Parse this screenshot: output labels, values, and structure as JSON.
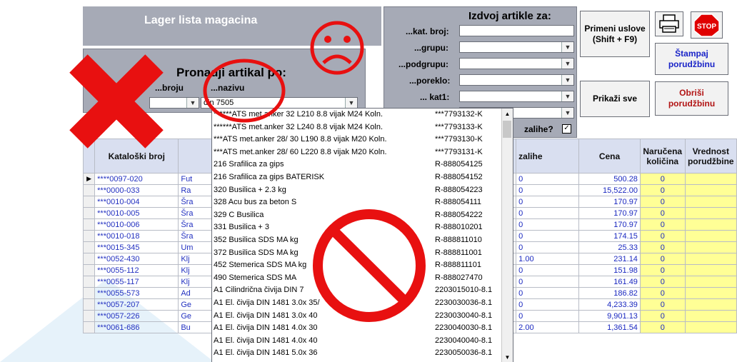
{
  "header": {
    "title": "Lager lista magacina"
  },
  "search_panel": {
    "title": "Pronadji artikal po:",
    "by_number_label": "...broju",
    "by_name_label": "...nazivu",
    "name_value": "din 7505"
  },
  "filter_panel": {
    "title": "Izdvoj artikle za:",
    "fields": [
      {
        "label": "...kat. broj:",
        "value": ""
      },
      {
        "label": "...grupu:",
        "value": ""
      },
      {
        "label": "...podgrupu:",
        "value": ""
      },
      {
        "label": "...poreklo:",
        "value": ""
      },
      {
        "label": "... kat1:",
        "value": ""
      }
    ],
    "stock_label": "zalihe?"
  },
  "buttons": {
    "apply": "Primeni uslove (Shift + F9)",
    "show_all": "Prikaži sve",
    "print_order": "Štampaj porudžbinu",
    "delete_order": "Obriši porudžbinu",
    "stop": "STOP",
    "print_icon": "printer-icon"
  },
  "table": {
    "headers": [
      "Kataloški broj",
      "",
      "zalihe",
      "Cena",
      "Naručena količina",
      "Vrednost porudžbine"
    ],
    "rows": [
      {
        "kat": "****0097-020",
        "naz": "Fut",
        "zal": "0",
        "cena": "500.28",
        "nar": "0"
      },
      {
        "kat": "***0000-033",
        "naz": "Ra",
        "zal": "0",
        "cena": "15,522.00",
        "nar": "0"
      },
      {
        "kat": "***0010-004",
        "naz": "Šra",
        "zal": "0",
        "cena": "170.97",
        "nar": "0"
      },
      {
        "kat": "***0010-005",
        "naz": "Šra",
        "zal": "0",
        "cena": "170.97",
        "nar": "0"
      },
      {
        "kat": "***0010-006",
        "naz": "Šra",
        "zal": "0",
        "cena": "170.97",
        "nar": "0"
      },
      {
        "kat": "***0010-018",
        "naz": "Šra",
        "zal": "0",
        "cena": "174.15",
        "nar": "0"
      },
      {
        "kat": "***0015-345",
        "naz": "Um",
        "zal": "0",
        "cena": "25.33",
        "nar": "0"
      },
      {
        "kat": "***0052-430",
        "naz": "Klj",
        "zal": "1.00",
        "cena": "231.14",
        "nar": "0"
      },
      {
        "kat": "***0055-112",
        "naz": "Klj",
        "zal": "0",
        "cena": "151.98",
        "nar": "0"
      },
      {
        "kat": "***0055-117",
        "naz": "Klj",
        "zal": "0",
        "cena": "161.49",
        "nar": "0"
      },
      {
        "kat": "***0055-573",
        "naz": "Ad",
        "zal": "0",
        "cena": "186.82",
        "nar": "0"
      },
      {
        "kat": "***0057-207",
        "naz": "Ge",
        "zal": "0",
        "cena": "4,233.39",
        "nar": "0"
      },
      {
        "kat": "***0057-226",
        "naz": "Ge",
        "zal": "0",
        "cena": "9,901.13",
        "nar": "0"
      },
      {
        "kat": "***0061-686",
        "naz": "Bu",
        "zal": "2.00",
        "cena": "1,361.54",
        "nar": "0"
      }
    ]
  },
  "dropdown_list": [
    {
      "name": "******ATS met.anker 32  L210 8.8  vijak M24 Koln.",
      "code": "***7793132-K"
    },
    {
      "name": "******ATS met.anker 32  L240 8.8  vijak M24 Koln.",
      "code": "***7793133-K"
    },
    {
      "name": "***ATS met.anker 28/ 30  L190 8.8  vijak M20 Koln.",
      "code": "***7793130-K"
    },
    {
      "name": "***ATS met.anker 28/ 60  L220 8.8  vijak M20 Koln.",
      "code": "***7793131-K"
    },
    {
      "name": "216 Srafilica za gips",
      "code": "R-888054125"
    },
    {
      "name": "216 Srafilica za gips  BATERISK",
      "code": "R-888054152"
    },
    {
      "name": "320 Busilica  +  2.3 kg",
      "code": "R-888054223"
    },
    {
      "name": "328 Acu bus za beton S",
      "code": "R-888054111"
    },
    {
      "name": "329 C  Busilica",
      "code": "R-888054222"
    },
    {
      "name": "331 Busilica  +        3",
      "code": "R-888010201"
    },
    {
      "name": "352 Busilica  SDS MA    kg",
      "code": "R-888811010"
    },
    {
      "name": "372 Busilica  SDS MA    kg",
      "code": "R-888811001"
    },
    {
      "name": "452 Stemerica  SDS MA     kg",
      "code": "R-888811101"
    },
    {
      "name": "490 Stemerica  SDS MA",
      "code": "R-888027470"
    },
    {
      "name": "A1  Cilindrična čivija DIN 7",
      "code": "2203015010-8.1"
    },
    {
      "name": "A1  El. čivija  DIN 1481   3.0x 35/",
      "code": "2230030036-8.1"
    },
    {
      "name": "A1  El. čivija  DIN 1481   3.0x 40",
      "code": "2230030040-8.1"
    },
    {
      "name": "A1  El. čivija  DIN 1481   4.0x 30",
      "code": "2230040030-8.1"
    },
    {
      "name": "A1  El. čivija  DIN 1481   4.0x 40",
      "code": "2230040040-8.1"
    },
    {
      "name": "A1  El. čivija  DIN 1481   5.0x 36",
      "code": "2230050036-8.1"
    }
  ],
  "colors": {
    "panel": "#a6aab6",
    "accent_red": "#e81010",
    "link_blue": "#2230c0",
    "yellow_cell": "#ffff96"
  }
}
